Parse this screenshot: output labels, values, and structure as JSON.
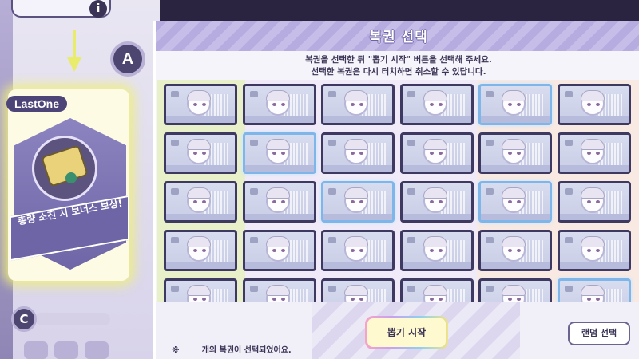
{
  "left_panel": {
    "a_badge": "A",
    "lastone_label": "LastOne",
    "bonus_text": "총량 소진 시 보너스 보상!",
    "c_badge": "C"
  },
  "modal": {
    "title": "복권 선택",
    "instruction_line1": "복권을 선택한 뒤 \"뽑기 시작\" 버튼을 선택해 주세요.",
    "instruction_line2": "선택한 복권은 다시 터치하면 취소할 수 있답니다.",
    "grid": {
      "rows": 5,
      "cols": 6,
      "selected": [
        [
          0,
          4
        ],
        [
          1,
          1
        ],
        [
          2,
          2
        ],
        [
          2,
          4
        ],
        [
          4,
          5
        ]
      ]
    },
    "footer": {
      "note_mark": "※",
      "count_value": "",
      "count_text": "개의 복권이 선택되었어요.",
      "start_button": "뽑기 시작",
      "random_button": "랜덤 선택"
    }
  },
  "colors": {
    "header": "#b7acdf",
    "ticket_border": "#3d3961",
    "ticket_selected_border": "#7fb6ea",
    "start_button_bg": "#fff9cf"
  }
}
